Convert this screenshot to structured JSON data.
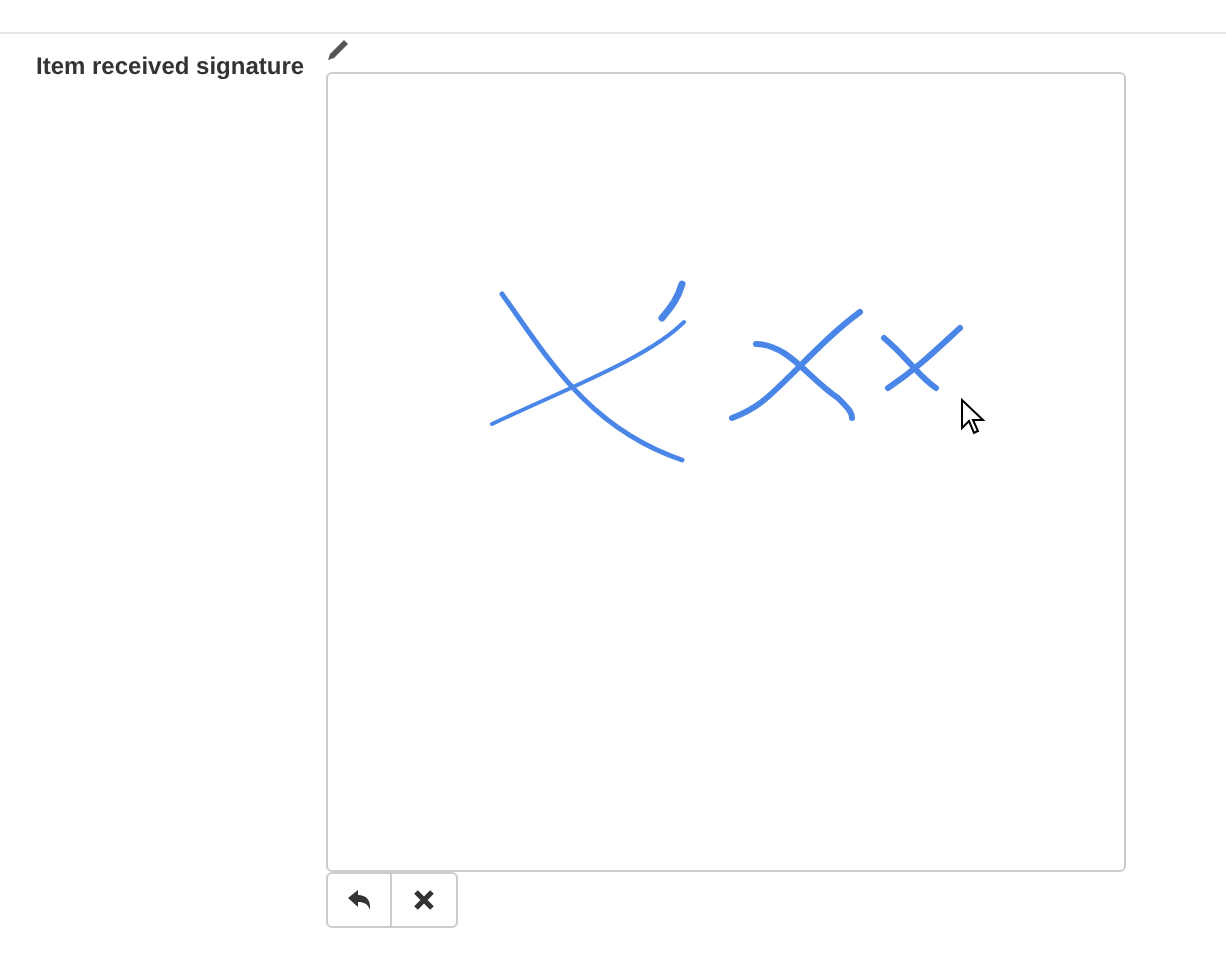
{
  "field": {
    "label": "Item received signature"
  },
  "buttons": [
    {
      "kind": "undo"
    },
    {
      "kind": "clear"
    }
  ]
}
